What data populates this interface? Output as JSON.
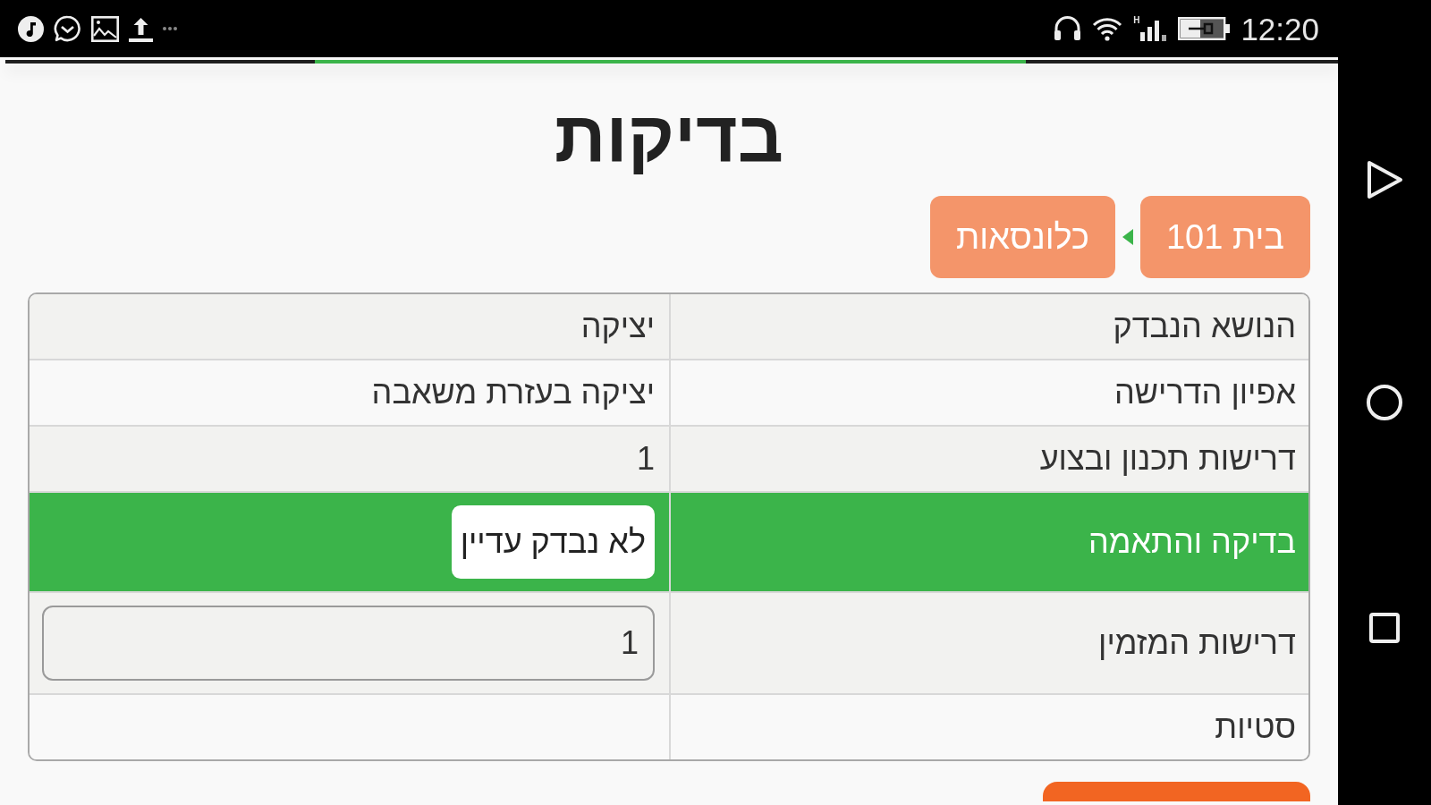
{
  "status_bar": {
    "network_type": "H",
    "time": "12:20"
  },
  "title": "בדיקות",
  "breadcrumb": [
    {
      "label": "בית 101"
    },
    {
      "label": "כלונסאות"
    }
  ],
  "table": {
    "rows": [
      {
        "label": "הנושא הנבדק",
        "kind": "text",
        "value": "יציקה",
        "selected": false
      },
      {
        "label": "אפיון הדרישה",
        "kind": "text",
        "value": "יציקה בעזרת משאבה",
        "selected": false
      },
      {
        "label": "דרישות תכנון ובצוע",
        "kind": "text",
        "value": "1",
        "selected": false
      },
      {
        "label": "בדיקה והתאמה",
        "kind": "button",
        "value": "לא נבדק עדיין",
        "selected": true
      },
      {
        "label": "דרישות המזמין",
        "kind": "input",
        "value": "1",
        "selected": false
      },
      {
        "label": "סטיות",
        "kind": "text",
        "selected": false
      }
    ]
  }
}
